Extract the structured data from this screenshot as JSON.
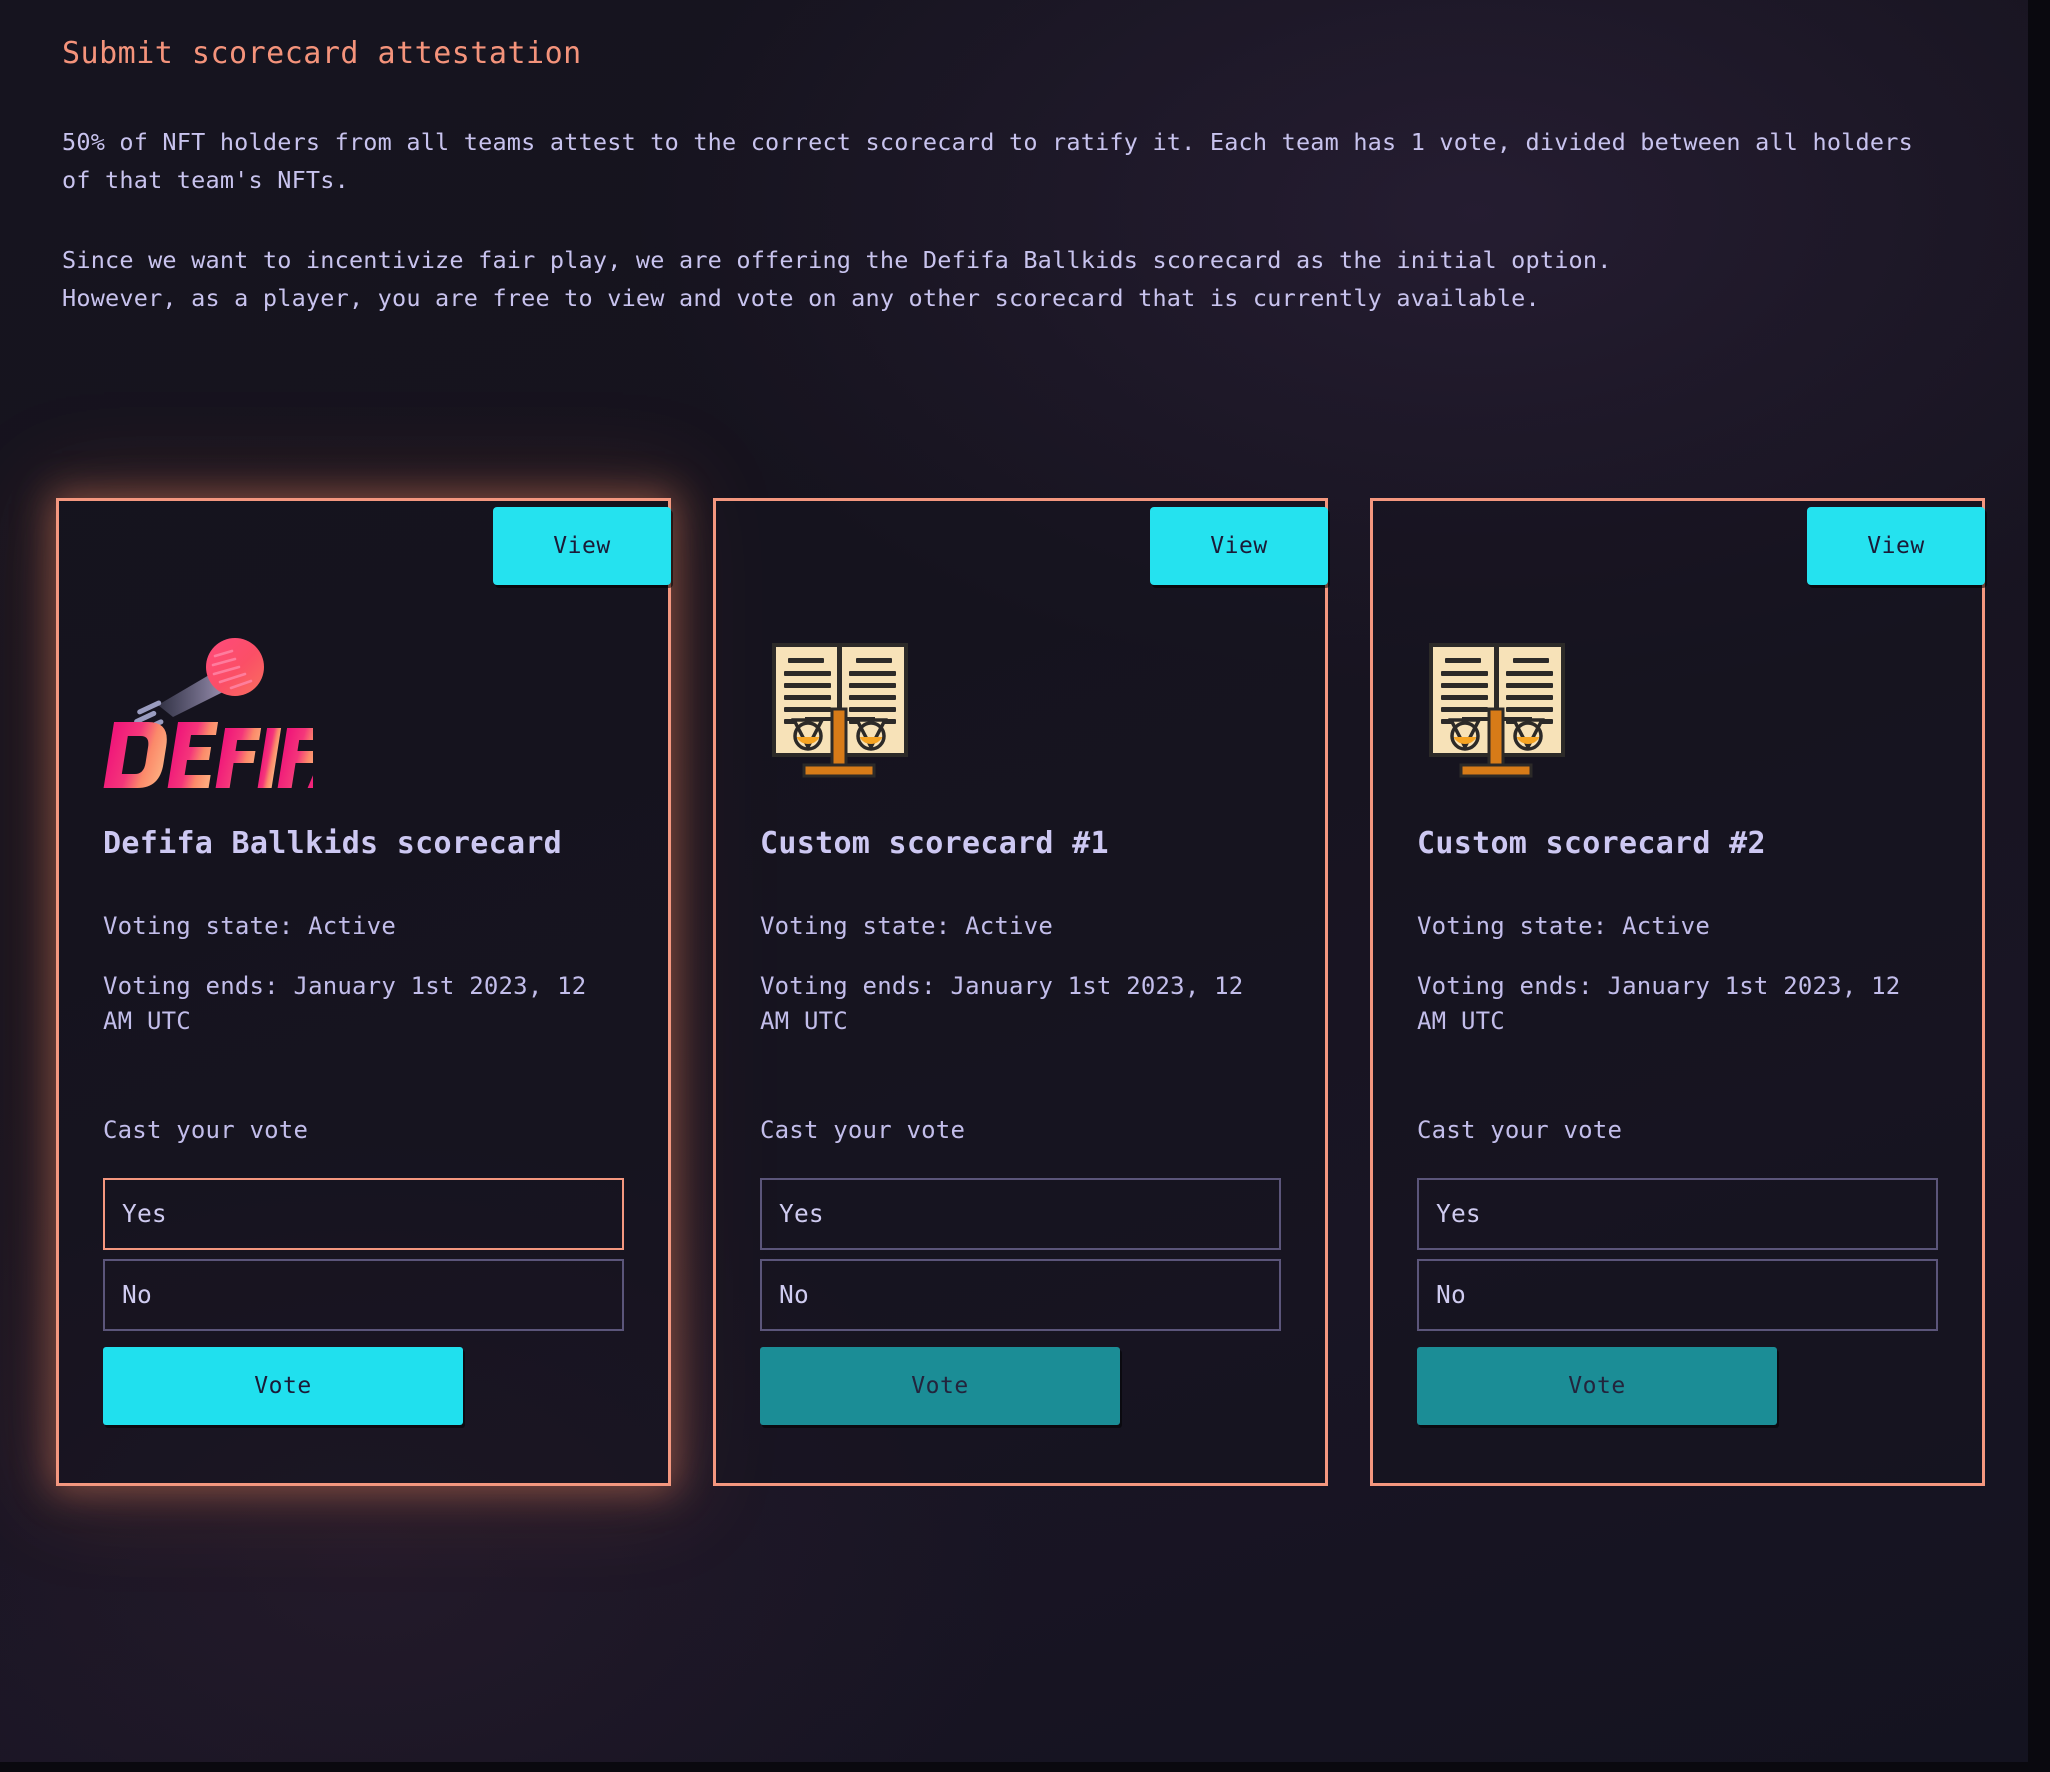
{
  "page": {
    "title": "Submit scorecard attestation",
    "paragraph_1": "50% of NFT holders from all teams attest to the correct scorecard to ratify it. Each team has 1 vote, divided between all holders of that team's NFTs.",
    "paragraph_2": "Since we want to incentivize fair play, we are offering the Defifa Ballkids scorecard as the initial option.\nHowever, as a player, you are free to view and vote on any other scorecard that is currently available."
  },
  "colors": {
    "accent_coral": "#f4977f",
    "accent_cyan": "#25e2ef",
    "accent_cyan_dim": "#1b8d96",
    "text_lavender": "#c2bdea",
    "page_background": "#16141f"
  },
  "labels": {
    "view": "View",
    "vote": "Vote",
    "cast_your_vote": "Cast your vote"
  },
  "cards": [
    {
      "id": "defifa-ballkids",
      "title": "Defifa Ballkids scorecard",
      "art": "defifa-logo",
      "voting_state": "Voting state: Active",
      "voting_ends": "Voting ends: January 1st 2023, 12 AM UTC",
      "cast_label": "Cast your vote",
      "view_label": "View",
      "vote_label": "Vote",
      "selected": true,
      "vote_enabled": true,
      "options": [
        {
          "label": "Yes",
          "selected": true
        },
        {
          "label": "No",
          "selected": false
        }
      ]
    },
    {
      "id": "custom-scorecard-1",
      "title": "Custom scorecard #1",
      "art": "scorecard-icon",
      "voting_state": "Voting state: Active",
      "voting_ends": "Voting ends: January 1st 2023, 12 AM UTC",
      "cast_label": "Cast your vote",
      "view_label": "View",
      "vote_label": "Vote",
      "selected": false,
      "vote_enabled": false,
      "options": [
        {
          "label": "Yes",
          "selected": false
        },
        {
          "label": "No",
          "selected": false
        }
      ]
    },
    {
      "id": "custom-scorecard-2",
      "title": "Custom scorecard #2",
      "art": "scorecard-icon",
      "voting_state": "Voting state: Active",
      "voting_ends": "Voting ends: January 1st 2023, 12 AM UTC",
      "cast_label": "Cast your vote",
      "view_label": "View",
      "vote_label": "Vote",
      "selected": false,
      "vote_enabled": false,
      "options": [
        {
          "label": "Yes",
          "selected": false
        },
        {
          "label": "No",
          "selected": false
        }
      ]
    }
  ]
}
